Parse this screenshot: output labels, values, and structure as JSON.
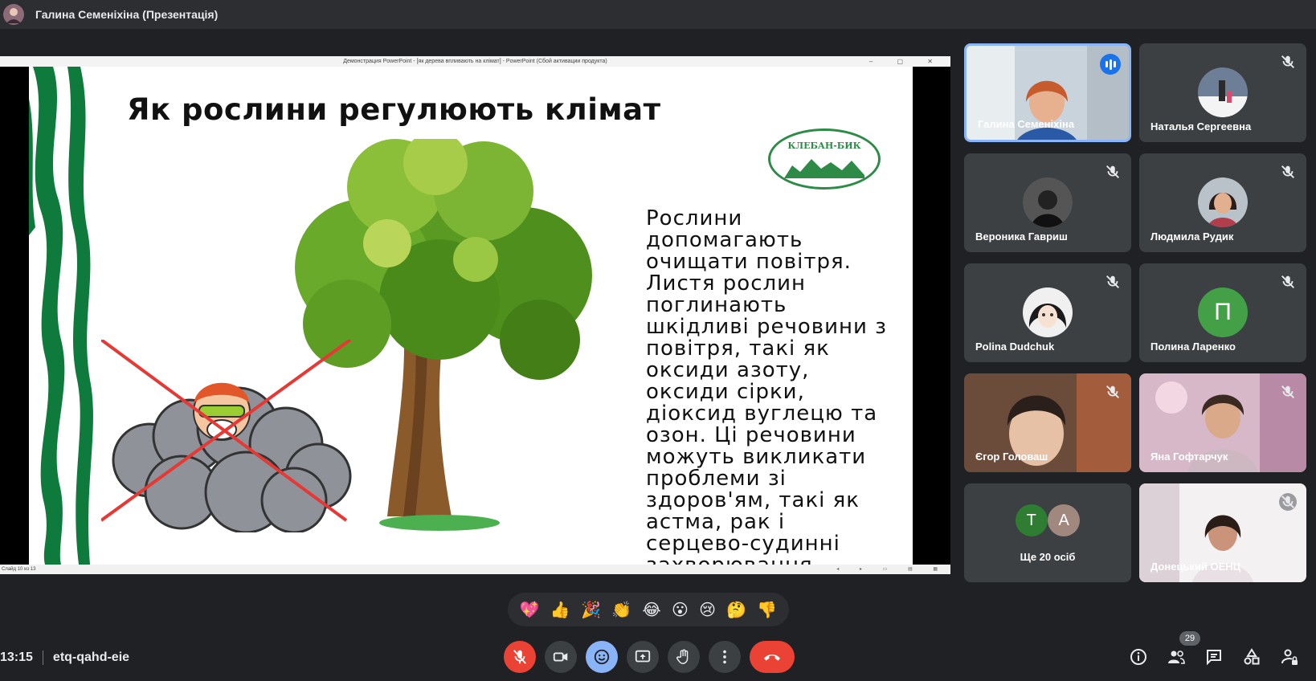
{
  "header": {
    "title": "Галина Семеніхіна (Презентація)"
  },
  "presentation": {
    "window_title": "Демонстрация PowerPoint - [як дерева впливають на клімат] - PowerPoint (Сбой активации продукта)",
    "status_text": "Слайд 10 из 13",
    "slide": {
      "heading": "Як рослини регулюють клімат",
      "body": "Рослини допомагають очищати повітря. Листя рослин поглинають шкідливі речовини з повітря, такі як оксиди азоту, оксиди сірки, діоксид вуглецю та озон. Ці речовини можуть викликати проблеми зі здоров'ям, такі як астма, рак і серцево-судинні захворювання.",
      "logo_text": "КЛЕБАН-БИК"
    }
  },
  "participants": [
    {
      "name": "Галина Семеніхіна",
      "speaking": true
    },
    {
      "name": "Наталья Сергеевна",
      "muted": true
    },
    {
      "name": "Вероника Гавриш",
      "muted": true
    },
    {
      "name": "Людмила Рудик",
      "muted": true
    },
    {
      "name": "Polina Dudchuk",
      "muted": true
    },
    {
      "name": "Полина Ларенко",
      "muted": true,
      "initial": "П"
    },
    {
      "name": "Єгор Головаш",
      "muted": true
    },
    {
      "name": "Яна Гофтарчук",
      "muted": true
    },
    {
      "name": "Ще 20 осіб",
      "initials": [
        "T",
        "A"
      ]
    },
    {
      "name": "Донецький ОЕНЦ",
      "muted": true
    }
  ],
  "reactions": [
    "💖",
    "👍",
    "🎉",
    "👏",
    "😂",
    "😮",
    "😢",
    "🤔",
    "👎"
  ],
  "footer": {
    "time": "13:15",
    "meeting_code": "etq-qahd-eie",
    "people_count": "29"
  },
  "colors": {
    "background": "#202124",
    "tile": "#3c4043",
    "accent": "#8ab4f8",
    "danger": "#ea4335",
    "avatar_green": "#43a047"
  }
}
